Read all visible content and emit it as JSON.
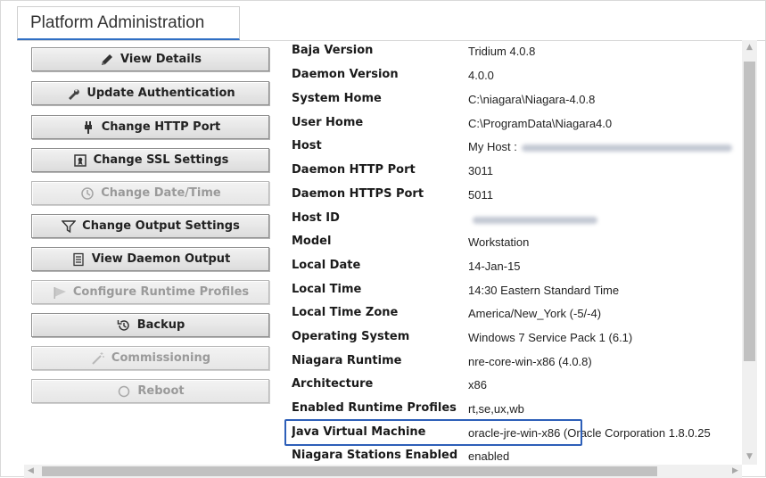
{
  "tab": {
    "title": "Platform Administration"
  },
  "buttons": [
    {
      "id": "view-details",
      "label": "View Details",
      "icon": "pencil-icon",
      "enabled": true
    },
    {
      "id": "update-authentication",
      "label": "Update Authentication",
      "icon": "wrench-icon",
      "enabled": true
    },
    {
      "id": "change-http-port",
      "label": "Change HTTP Port",
      "icon": "plug-icon",
      "enabled": true
    },
    {
      "id": "change-ssl-settings",
      "label": "Change SSL Settings",
      "icon": "certificate-icon",
      "enabled": true
    },
    {
      "id": "change-date-time",
      "label": "Change Date/Time",
      "icon": "clock-icon",
      "enabled": false
    },
    {
      "id": "change-output-settings",
      "label": "Change Output Settings",
      "icon": "filter-icon",
      "enabled": true
    },
    {
      "id": "view-daemon-output",
      "label": "View Daemon Output",
      "icon": "document-icon",
      "enabled": true
    },
    {
      "id": "configure-runtime-profiles",
      "label": "Configure Runtime Profiles",
      "icon": "flag-icon",
      "enabled": false
    },
    {
      "id": "backup",
      "label": "Backup",
      "icon": "history-icon",
      "enabled": true
    },
    {
      "id": "commissioning",
      "label": "Commissioning",
      "icon": "wand-icon",
      "enabled": false
    },
    {
      "id": "reboot",
      "label": "Reboot",
      "icon": "power-icon",
      "enabled": false
    }
  ],
  "properties": [
    {
      "key": "Baja Version",
      "value": "Tridium 4.0.8"
    },
    {
      "key": "Daemon Version",
      "value": "4.0.0"
    },
    {
      "key": "System Home",
      "value": "C:\\niagara\\Niagara-4.0.8"
    },
    {
      "key": "User Home",
      "value": "C:\\ProgramData\\Niagara4.0"
    },
    {
      "key": "Host",
      "value": "My Host :",
      "redacted": true
    },
    {
      "key": "Daemon HTTP Port",
      "value": "3011"
    },
    {
      "key": "Daemon HTTPS Port",
      "value": "5011"
    },
    {
      "key": "Host ID",
      "value": "",
      "redacted": true
    },
    {
      "key": "Model",
      "value": "Workstation"
    },
    {
      "key": "Local Date",
      "value": "14-Jan-15"
    },
    {
      "key": "Local Time",
      "value": "14:30 Eastern Standard Time"
    },
    {
      "key": "Local Time Zone",
      "value": "America/New_York (-5/-4)"
    },
    {
      "key": "Operating System",
      "value": "Windows 7 Service Pack 1 (6.1)"
    },
    {
      "key": "Niagara Runtime",
      "value": "nre-core-win-x86 (4.0.8)"
    },
    {
      "key": "Architecture",
      "value": "x86"
    },
    {
      "key": "Enabled Runtime Profiles",
      "value": "rt,se,ux,wb"
    },
    {
      "key": "Java Virtual Machine",
      "value": "oracle-jre-win-x86 (Oracle Corporation 1.8.0.25",
      "highlighted": true
    },
    {
      "key": "Niagara Stations Enabled",
      "value": "enabled"
    }
  ],
  "colors": {
    "highlight": "#2d5fb8",
    "tab_underline": "#2f6fc4"
  }
}
